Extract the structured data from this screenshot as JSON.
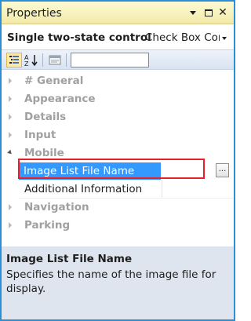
{
  "window": {
    "title": "Properties",
    "accent_color": "#2a8fd4",
    "titlebar_color": "#f3e9a8"
  },
  "selector": {
    "object_name": "Single two-state control",
    "object_type": "Check Box Cor"
  },
  "toolbar": {
    "categorized_icon": "categorized-icon",
    "alphabetical_icon": "alphabetical-icon",
    "property_pages_icon": "property-pages-icon",
    "search_value": ""
  },
  "grid": {
    "categories": [
      {
        "label": "# General",
        "expanded": false
      },
      {
        "label": "Appearance",
        "expanded": false
      },
      {
        "label": "Details",
        "expanded": false
      },
      {
        "label": "Input",
        "expanded": false
      },
      {
        "label": "Mobile",
        "expanded": true
      },
      {
        "label": "Navigation",
        "expanded": false
      },
      {
        "label": "Parking",
        "expanded": false
      }
    ],
    "mobile_properties": [
      {
        "label": "Image List File Name",
        "selected": true,
        "ellipsis": "..."
      },
      {
        "label": "Additional Information",
        "selected": false
      }
    ],
    "selection_color": "#3399ff",
    "highlight_color": "#e81e2b"
  },
  "description": {
    "title": "Image List File Name",
    "text": "Specifies the name of the image file for display."
  }
}
